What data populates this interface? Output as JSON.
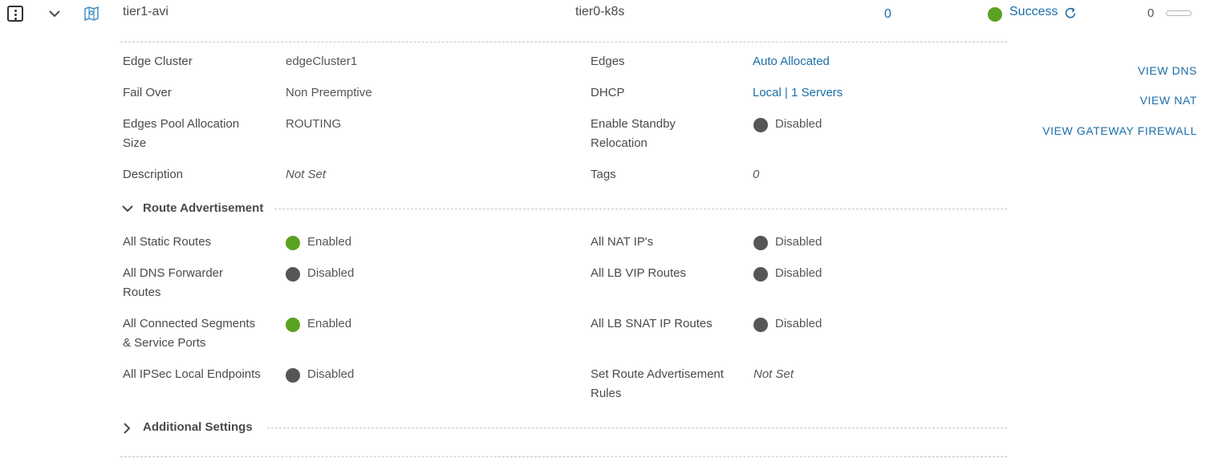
{
  "row": {
    "name": "tier1-avi",
    "linked_gateway": "tier0-k8s",
    "count": "0",
    "status": "Success",
    "alarms": "0"
  },
  "details": {
    "left": [
      {
        "label": "Edge Cluster",
        "value": "edgeCluster1"
      },
      {
        "label": "Fail Over",
        "value": "Non Preemptive"
      },
      {
        "label_line1": "Edges Pool Allocation",
        "label_line2": "Size",
        "value": "ROUTING"
      },
      {
        "label": "Description",
        "value": "Not Set"
      }
    ],
    "right": [
      {
        "label": "Edges",
        "value": "Auto Allocated"
      },
      {
        "label": "DHCP",
        "value": "Local | 1 Servers"
      },
      {
        "label_line1": "Enable Standby",
        "label_line2": "Relocation",
        "value": "Disabled"
      },
      {
        "label": "Tags",
        "value": "0"
      }
    ]
  },
  "actions": {
    "view_dns": "VIEW DNS",
    "view_nat": "VIEW NAT",
    "view_firewall": "VIEW GATEWAY FIREWALL"
  },
  "route_advertisement": {
    "title": "Route Advertisement",
    "left": [
      {
        "label": "All Static Routes",
        "value": "Enabled",
        "state": "enabled"
      },
      {
        "label_line1": "All DNS Forwarder",
        "label_line2": "Routes",
        "value": "Disabled",
        "state": "disabled"
      },
      {
        "label_line1": "All Connected Segments",
        "label_line2": "& Service Ports",
        "value": "Enabled",
        "state": "enabled"
      },
      {
        "label": "All IPSec Local Endpoints",
        "value": "Disabled",
        "state": "disabled"
      }
    ],
    "right": [
      {
        "label": "All NAT IP's",
        "value": "Disabled",
        "state": "disabled"
      },
      {
        "label": "All LB VIP Routes",
        "value": "Disabled",
        "state": "disabled"
      },
      {
        "label": "All LB SNAT IP Routes",
        "value": "Disabled",
        "state": "disabled"
      },
      {
        "label_line1": "Set Route Advertisement",
        "label_line2": "Rules",
        "value": "Not Set"
      }
    ]
  },
  "additional_settings": {
    "title": "Additional Settings"
  },
  "colors": {
    "enabled": "#5aa220",
    "disabled": "#565656",
    "link": "#1b6ea8"
  },
  "icons": [
    "kebab-menu-icon",
    "chevron-down-icon",
    "gateway-map-icon",
    "refresh-icon",
    "chevron-right-icon"
  ]
}
